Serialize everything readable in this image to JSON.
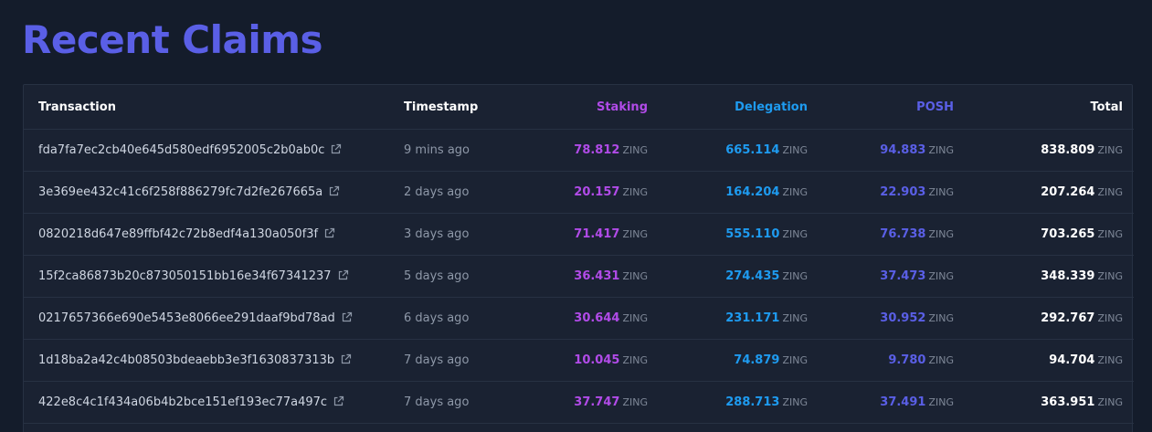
{
  "page": {
    "title": "Recent Claims"
  },
  "table": {
    "headers": {
      "transaction": "Transaction",
      "timestamp": "Timestamp",
      "staking": "Staking",
      "delegation": "Delegation",
      "posh": "POSH",
      "total": "Total"
    },
    "unit": "ZING",
    "rows": [
      {
        "tx": "fda7fa7ec2cb40e645d580edf6952005c2b0ab0c",
        "time": "9 mins ago",
        "staking": "78.812",
        "delegation": "665.114",
        "posh": "94.883",
        "total": "838.809"
      },
      {
        "tx": "3e369ee432c41c6f258f886279fc7d2fe267665a",
        "time": "2 days ago",
        "staking": "20.157",
        "delegation": "164.204",
        "posh": "22.903",
        "total": "207.264"
      },
      {
        "tx": "0820218d647e89ffbf42c72b8edf4a130a050f3f",
        "time": "3 days ago",
        "staking": "71.417",
        "delegation": "555.110",
        "posh": "76.738",
        "total": "703.265"
      },
      {
        "tx": "15f2ca86873b20c873050151bb16e34f67341237",
        "time": "5 days ago",
        "staking": "36.431",
        "delegation": "274.435",
        "posh": "37.473",
        "total": "348.339"
      },
      {
        "tx": "0217657366e690e5453e8066ee291daaf9bd78ad",
        "time": "6 days ago",
        "staking": "30.644",
        "delegation": "231.171",
        "posh": "30.952",
        "total": "292.767"
      },
      {
        "tx": "1d18ba2a42c4b08503bdeaebb3e3f1630837313b",
        "time": "7 days ago",
        "staking": "10.045",
        "delegation": "74.879",
        "posh": "9.780",
        "total": "94.704"
      },
      {
        "tx": "422e8c4c1f434a06b4b2bce151ef193ec77a497c",
        "time": "7 days ago",
        "staking": "37.747",
        "delegation": "288.713",
        "posh": "37.491",
        "total": "363.951"
      }
    ]
  },
  "colors": {
    "title": "#5a5fe6",
    "staking": "#b14be8",
    "delegation": "#1e9bf0",
    "posh": "#5a5fe6",
    "total": "#ffffff"
  },
  "icons": {
    "external_link": "external-link-icon"
  }
}
